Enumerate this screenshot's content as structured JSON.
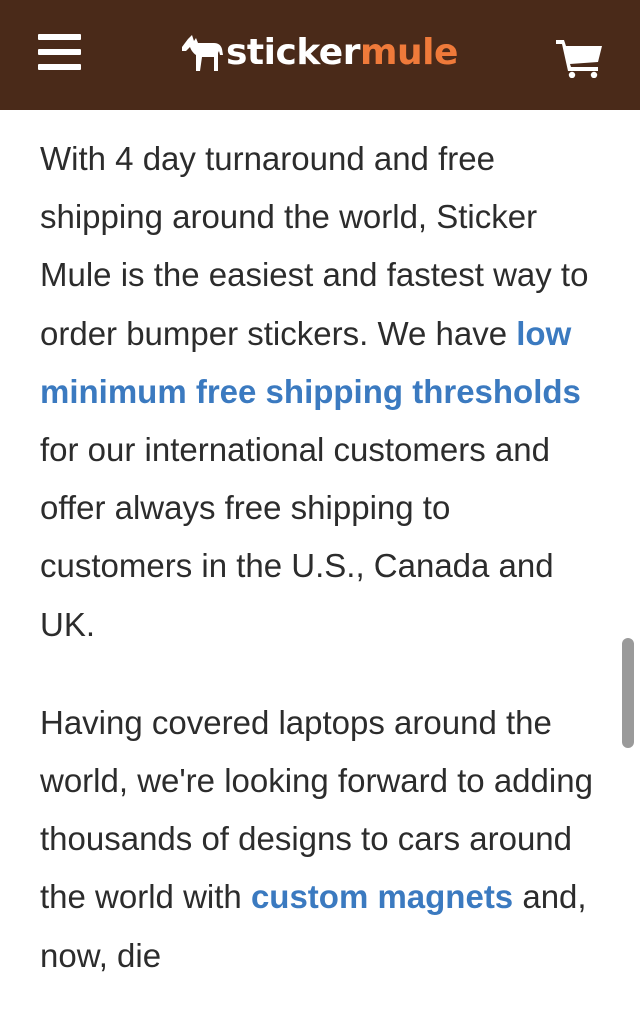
{
  "header": {
    "brand_part1": "sticker",
    "brand_part2": "mule",
    "colors": {
      "background": "#4a2a19",
      "accent": "#ef7a3a",
      "link": "#3b7ac0"
    }
  },
  "icons": {
    "menu": "hamburger-menu-icon",
    "logo": "mule-logo-icon",
    "cart": "shopping-cart-icon"
  },
  "content": {
    "p1": {
      "text_before": "With 4 day turnaround and free shipping around the world, Sticker Mule is the easiest and fastest way to order bumper stickers. We have ",
      "link": "low minimum free shipping thresholds",
      "text_after": " for our international customers and offer always free shipping to customers in the U.S., Canada and UK."
    },
    "p2": {
      "text_before": "Having covered laptops around the world, we're looking forward to adding thousands of designs to cars around the world with ",
      "link": "custom magnets",
      "text_after": " and, now, die"
    }
  }
}
